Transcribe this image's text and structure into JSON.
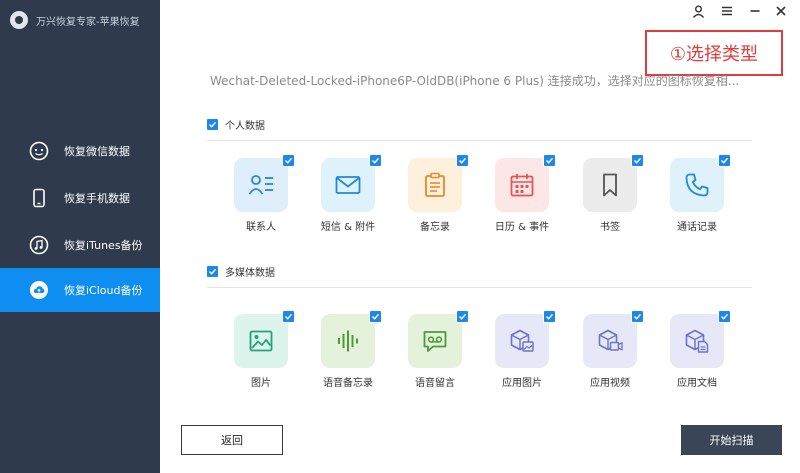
{
  "app": {
    "title": "万兴恢复专家-苹果恢复"
  },
  "sidebar": {
    "items": [
      {
        "label": "恢复微信数据",
        "icon": "chat-bubble-icon",
        "active": false
      },
      {
        "label": "恢复手机数据",
        "icon": "phone-icon",
        "active": false
      },
      {
        "label": "恢复iTunes备份",
        "icon": "music-note-icon",
        "active": false
      },
      {
        "label": "恢复iCloud备份",
        "icon": "cloud-icon",
        "active": true
      }
    ]
  },
  "annotation": {
    "text": "①选择类型",
    "color": "#e23b3b"
  },
  "device_status": "Wechat-Deleted-Locked-iPhone6P-OldDB(iPhone  6  Plus) 连接成功，选择对应的图标恢复相...",
  "sections": {
    "personal": {
      "title": "个人数据",
      "checked": true,
      "items": [
        {
          "label": "联系人",
          "icon": "contacts-icon",
          "checked": true
        },
        {
          "label": "短信 & 附件",
          "icon": "message-icon",
          "checked": true
        },
        {
          "label": "备忘录",
          "icon": "notes-icon",
          "checked": true
        },
        {
          "label": "日历 & 事件",
          "icon": "calendar-icon",
          "checked": true
        },
        {
          "label": "书签",
          "icon": "bookmark-icon",
          "checked": true
        },
        {
          "label": "通话记录",
          "icon": "call-log-icon",
          "checked": true
        }
      ]
    },
    "media": {
      "title": "多媒体数据",
      "checked": true,
      "items": [
        {
          "label": "图片",
          "icon": "photo-icon",
          "checked": true
        },
        {
          "label": "语音备忘录",
          "icon": "voice-memo-icon",
          "checked": true
        },
        {
          "label": "语音留言",
          "icon": "voicemail-icon",
          "checked": true
        },
        {
          "label": "应用图片",
          "icon": "app-photo-icon",
          "checked": true
        },
        {
          "label": "应用视频",
          "icon": "app-video-icon",
          "checked": true
        },
        {
          "label": "应用文档",
          "icon": "app-document-icon",
          "checked": true
        }
      ]
    }
  },
  "buttons": {
    "back": "返回",
    "start": "开始扫描"
  },
  "colors": {
    "sidebar_bg": "#2f3b4c",
    "active_nav": "#0d8ef0",
    "checkbox": "#1e88e5",
    "start_button": "#3a4656"
  }
}
